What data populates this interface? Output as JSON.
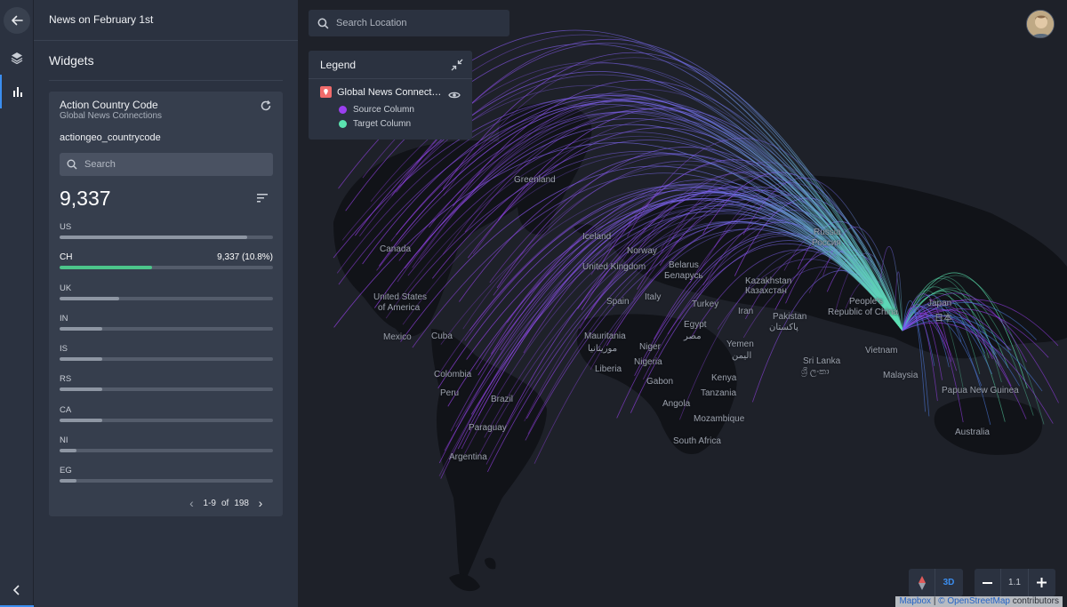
{
  "header": {
    "title": "News on February 1st"
  },
  "panel": {
    "section_title": "Widgets"
  },
  "widget": {
    "title": "Action Country Code",
    "subtitle": "Global News Connections",
    "column": "actiongeo_countrycode",
    "search_placeholder": "Search",
    "total": "9,337",
    "rows": [
      {
        "code": "US",
        "fraction": 0.22,
        "value": ""
      },
      {
        "code": "CH",
        "fraction": 0.108,
        "value": "9,337  (10.8%)",
        "selected": true
      },
      {
        "code": "UK",
        "fraction": 0.07,
        "value": ""
      },
      {
        "code": "IN",
        "fraction": 0.05,
        "value": ""
      },
      {
        "code": "IS",
        "fraction": 0.05,
        "value": ""
      },
      {
        "code": "RS",
        "fraction": 0.05,
        "value": ""
      },
      {
        "code": "CA",
        "fraction": 0.05,
        "value": ""
      },
      {
        "code": "NI",
        "fraction": 0.02,
        "value": ""
      },
      {
        "code": "EG",
        "fraction": 0.02,
        "value": ""
      }
    ],
    "pager": {
      "range": "1-9",
      "of": "of",
      "total": "198"
    }
  },
  "map": {
    "search_placeholder": "Search Location",
    "legend": {
      "title": "Legend",
      "layer_name": "Global News Connections",
      "items": [
        {
          "label": "Source Column",
          "color": "#9b3ff0"
        },
        {
          "label": "Target Column",
          "color": "#5be3b0"
        }
      ]
    },
    "labels": [
      "Greenland",
      "Iceland",
      "Canada",
      "Norway",
      "Russia",
      "Россия",
      "United Kingdom",
      "Belarus",
      "Беларусь",
      "Kazakhstan",
      "Казахстан",
      "United States",
      "of America",
      "Spain",
      "Italy",
      "Turkey",
      "People's",
      "Republic of China",
      "Japan",
      "日本",
      "Iran",
      "Pakistan",
      "پاکستان",
      "Mexico",
      "Cuba",
      "Mauritania",
      "موريتانيا",
      "Egypt",
      "مصر",
      "Niger",
      "Yemen",
      "اليمن",
      "Liberia",
      "Nigeria",
      "Sri Lanka",
      "ශ්‍රී ලංකා",
      "Vietnam",
      "Malaysia",
      "Colombia",
      "Gabon",
      "Kenya",
      "Peru",
      "Brazil",
      "Tanzania",
      "Papua New Guinea",
      "Angola",
      "Paraguay",
      "Mozambique",
      "Australia",
      "South Africa",
      "Argentina"
    ],
    "nav_mode": "3D",
    "zoom": "1.1",
    "attribution": {
      "mapbox": "Mapbox",
      "sep": "|",
      "osm": "© OpenStreetMap",
      "suffix": "contributors"
    }
  }
}
